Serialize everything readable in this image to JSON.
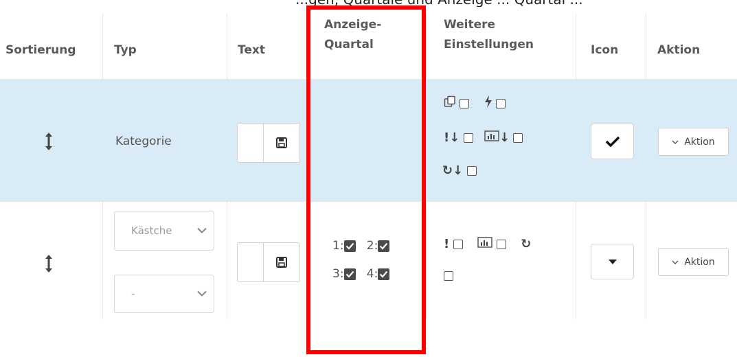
{
  "top_clipped_text": "...gen, Quartale und Anzeige ... Quartal ...",
  "headers": {
    "sortierung": "Sortierung",
    "typ": "Typ",
    "text": "Text",
    "anzeige_line1": "Anzeige-",
    "anzeige_line2": "Quartal",
    "weitere_line1": "Weitere",
    "weitere_line2": "Einstellungen",
    "icon": "Icon",
    "aktion": "Aktion"
  },
  "rows": [
    {
      "typ": "Kategorie",
      "aktion_label": "Aktion"
    },
    {
      "typ_select": "Kästche",
      "sub_select": "-",
      "quartal": [
        {
          "label": "1:"
        },
        {
          "label": "2:"
        },
        {
          "label": "3:"
        },
        {
          "label": "4:"
        }
      ],
      "aktion_label": "Aktion"
    }
  ],
  "colors": {
    "highlight": "#ff0000",
    "row_highlight": "#d9ebf6"
  }
}
